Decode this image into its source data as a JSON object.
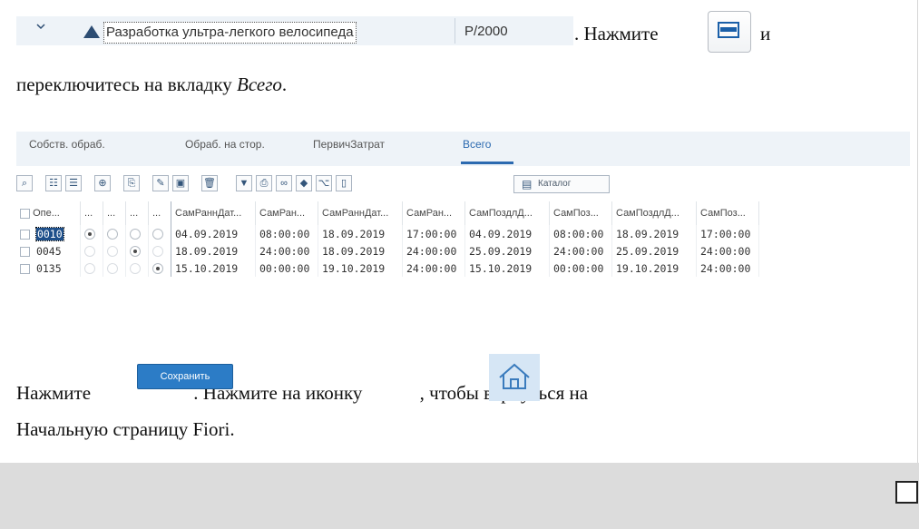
{
  "row1": {
    "tree_label": "Разработка ультра-легкого велосипеда",
    "tree_code": "P/2000",
    "sentence_part1": ". Нажмите",
    "sentence_part2": "и"
  },
  "row2": {
    "text_prefix": "переключитесь на вкладку ",
    "tab_name_italic": "Всего",
    "text_suffix": "."
  },
  "tabs": [
    "Собств. обраб.",
    "Обраб. на стор.",
    "ПервичЗатрат",
    "Всего"
  ],
  "active_tab": "Всего",
  "toolbar": {
    "catalog_label": "Каталог"
  },
  "grid": {
    "headers": [
      "Опе...",
      "...",
      "...",
      "...",
      "...",
      "СамРаннДат...",
      "СамРан...",
      "СамРаннДат...",
      "СамРан...",
      "СамПоздлД...",
      "СамПоз...",
      "СамПоздлД...",
      "СамПоз..."
    ],
    "rows": [
      {
        "op": "0010",
        "radio": 1,
        "values": [
          "04.09.2019",
          "08:00:00",
          "18.09.2019",
          "17:00:00",
          "04.09.2019",
          "08:00:00",
          "18.09.2019",
          "17:00:00"
        ]
      },
      {
        "op": "0045",
        "radio": 3,
        "values": [
          "18.09.2019",
          "24:00:00",
          "18.09.2019",
          "24:00:00",
          "25.09.2019",
          "24:00:00",
          "25.09.2019",
          "24:00:00"
        ]
      },
      {
        "op": "0135",
        "radio": 4,
        "values": [
          "15.10.2019",
          "00:00:00",
          "19.10.2019",
          "24:00:00",
          "15.10.2019",
          "00:00:00",
          "19.10.2019",
          "24:00:00"
        ]
      }
    ]
  },
  "row3": {
    "prefix": "Нажмите ",
    "save_label": "Сохранить",
    "middle": ". Нажмите на иконку ",
    "suffix": ", чтобы вернуться на"
  },
  "row4": {
    "text": "Начальную страницу Fiori."
  }
}
